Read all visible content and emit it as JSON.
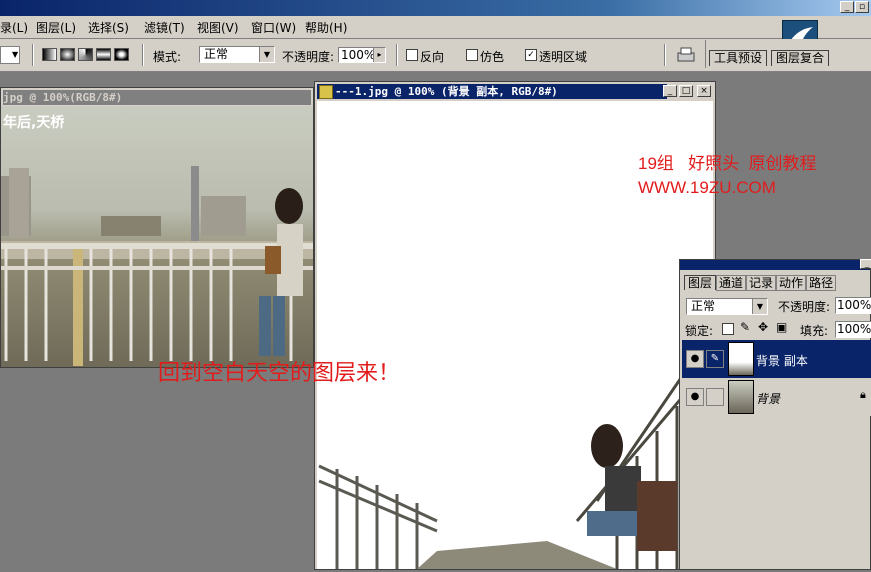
{
  "menu": {
    "items": [
      "录(L)",
      "图层(L)",
      "选择(S)",
      "滤镜(T)",
      "视图(V)",
      "窗口(W)",
      "帮助(H)"
    ]
  },
  "options": {
    "mode_label": "模式:",
    "mode_value": "正常",
    "opacity_label": "不透明度:",
    "opacity_value": "100%",
    "reverse_label": "反向",
    "dither_label": "仿色",
    "transparency_label": "透明区域",
    "tab_tool_presets": "工具预设",
    "tab_layer_comps": "图层复合"
  },
  "left_doc": {
    "title": "jpg @ 100%(RGB/8#)",
    "watermark": "年后,天桥"
  },
  "main_doc": {
    "title": "---1.jpg @ 100% (背景 副本, RGB/8#)"
  },
  "annotations": {
    "group": "19组   好照头  原创教程",
    "url": "WWW.19ZU.COM",
    "instruction": "回到空白天空的图层来！"
  },
  "layers_panel": {
    "tabs": [
      "图层",
      "通道",
      "记录",
      "动作",
      "路径"
    ],
    "blend_mode": "正常",
    "opacity_label": "不透明度:",
    "opacity_value": "100%",
    "lock_label": "锁定:",
    "fill_label": "填充:",
    "fill_value": "100%",
    "layers": [
      {
        "name": "背景 副本",
        "selected": true
      },
      {
        "name": "背景",
        "selected": false
      }
    ]
  },
  "colors": {
    "accent_selection": "#0a246a",
    "annotation_red": "#e21c1c",
    "chrome": "#d4d0c8",
    "workspace": "#7b7b7b"
  }
}
